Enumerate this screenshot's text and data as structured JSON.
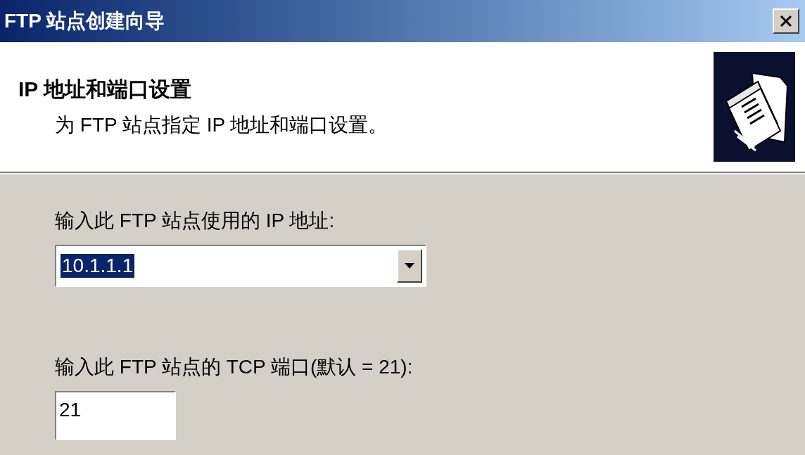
{
  "window": {
    "title": "FTP 站点创建向导"
  },
  "header": {
    "title": "IP 地址和端口设置",
    "subtitle": "为 FTP 站点指定 IP 地址和端口设置。"
  },
  "fields": [
    {
      "kind": "dropdown",
      "label": "输入此 FTP 站点使用的 IP 地址:",
      "value": "10.1.1.1",
      "selected": true
    },
    {
      "kind": "text",
      "label": "输入此 FTP 站点的 TCP 端口(默认 = 21):",
      "value": "21",
      "selected": false
    }
  ]
}
